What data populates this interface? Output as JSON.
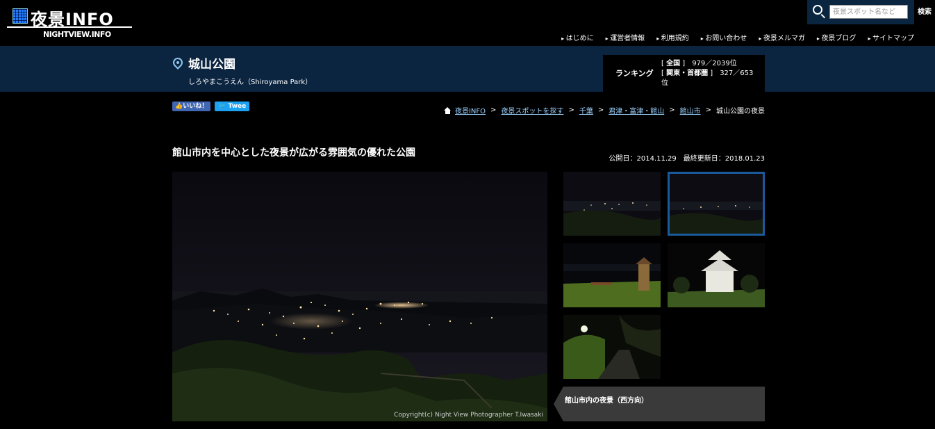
{
  "header": {
    "logo_text": "夜景INFO",
    "logo_sub": "NIGHTVIEW.INFO",
    "search_placeholder": "夜景スポット名など",
    "search_button": "検索",
    "nav": [
      "はじめに",
      "運営者情報",
      "利用規約",
      "お問い合わせ",
      "夜景メルマガ",
      "夜景ブログ",
      "サイトマップ"
    ]
  },
  "spot": {
    "title": "城山公園",
    "reading": "しろやまこうえん（Shiroyama Park）"
  },
  "ranking": {
    "label": "ランキング",
    "national_tag": "全国",
    "national_value": "979／2039位",
    "region_tag": "関東・首都圏",
    "region_value": "327／653位"
  },
  "social": {
    "like": "👍いいね！",
    "tweet": "🐦 Twee"
  },
  "breadcrumb": {
    "items": [
      "夜景INFO",
      "夜景スポットを探す",
      "千葉",
      "君津・富津・館山",
      "館山市"
    ],
    "current": "城山公園の夜景"
  },
  "article": {
    "headline": "館山市内を中心とした夜景が広がる雰囲気の優れた公園",
    "dates": "公開日：2014.11.29　最終更新日：2018.01.23",
    "credit": "Copyright(c) Night View Photographer T.Iwasaki",
    "caption": "館山市内の夜景（西方向）"
  },
  "colors": {
    "band": "#0b2440",
    "link": "#9cd2ff",
    "selected_border": "#1a5a9a"
  }
}
